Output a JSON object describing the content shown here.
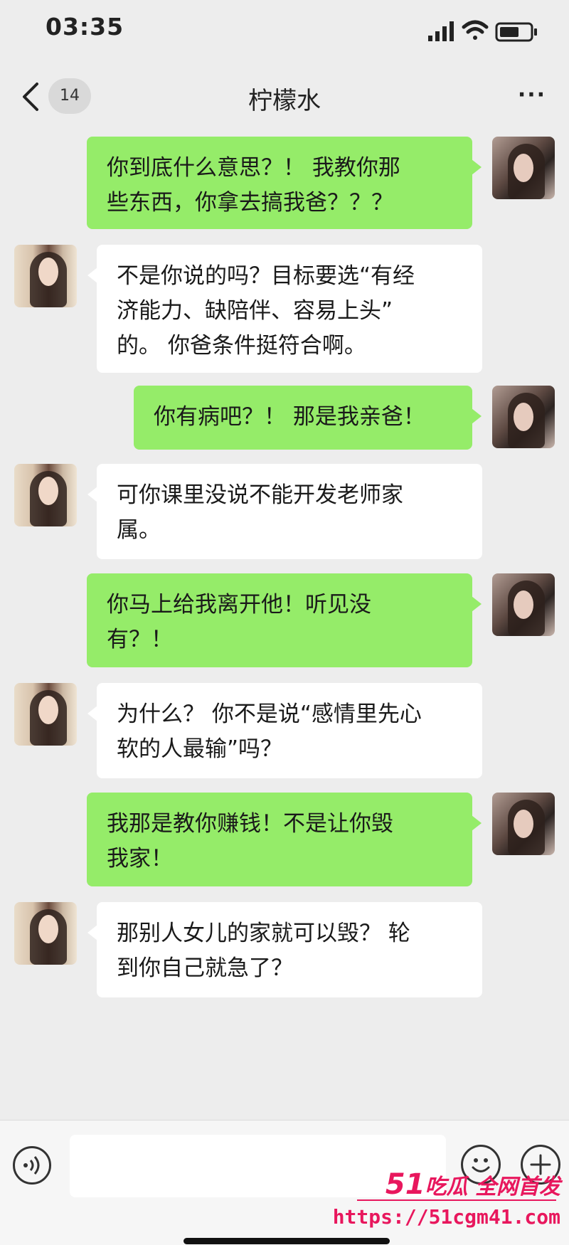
{
  "status_bar": {
    "time": "03:35"
  },
  "nav": {
    "unread_count": "14",
    "title": "柠檬水",
    "more": "···"
  },
  "messages": [
    {
      "sender": "self",
      "text": "你到底什么意思？！ 我教你那\n些东西，你拿去搞我爸？？？"
    },
    {
      "sender": "other",
      "text": "不是你说的吗？目标要选“有经\n济能力、缺陪伴、容易上头”\n的。 你爸条件挺符合啊。"
    },
    {
      "sender": "self",
      "text": "你有病吧？！ 那是我亲爸！"
    },
    {
      "sender": "other",
      "text": "可你课里没说不能开发老师家\n属。"
    },
    {
      "sender": "self",
      "text": "你马上给我离开他！听见没\n有？！"
    },
    {
      "sender": "other",
      "text": "为什么？ 你不是说“感情里先心\n软的人最输”吗？"
    },
    {
      "sender": "self",
      "text": "我那是教你赚钱！不是让你毁\n我家！"
    },
    {
      "sender": "other",
      "text": "那别人女儿的家就可以毁？ 轮\n到你自己就急了？"
    }
  ],
  "input_bar": {
    "placeholder": ""
  },
  "watermark": {
    "brand_num": "51",
    "brand_text": "吃瓜 全网首发",
    "url": "https://51cgm41.com"
  },
  "colors": {
    "self_bubble": "#95ec69",
    "other_bubble": "#ffffff",
    "background": "#ededed",
    "watermark": "#e8175d"
  }
}
